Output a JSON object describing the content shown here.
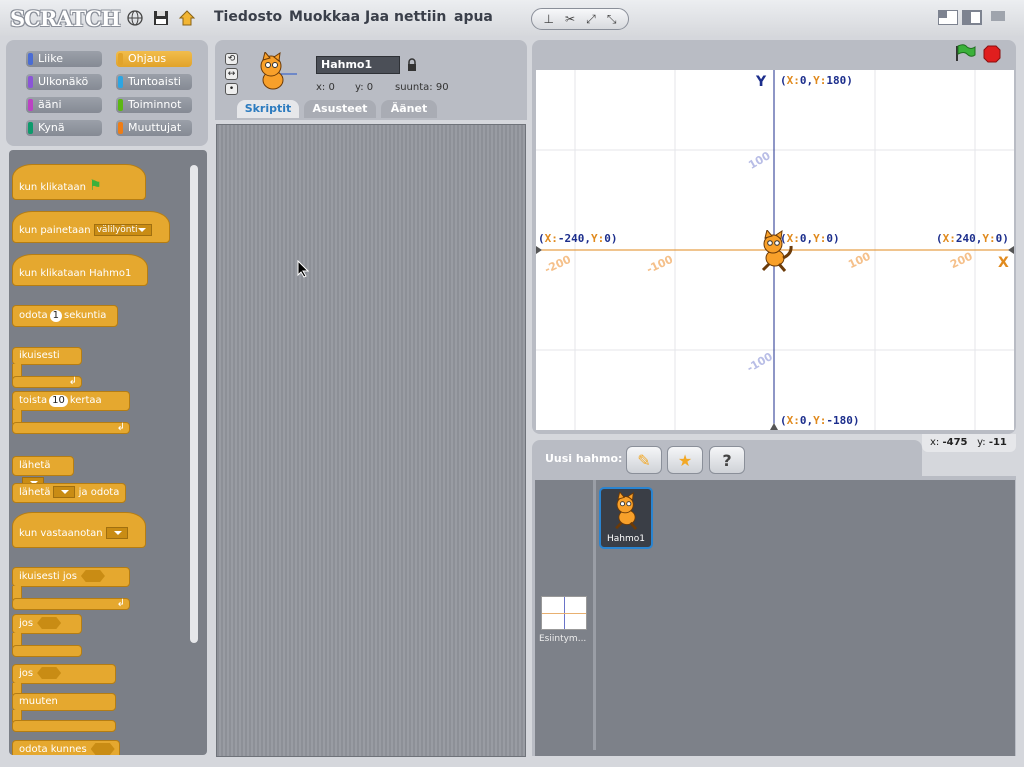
{
  "app": {
    "logo": "SCRATCH"
  },
  "menu": {
    "items": [
      "Tiedosto",
      "Muokkaa",
      "Jaa nettiin",
      "apua"
    ]
  },
  "categories": [
    {
      "label": "Liike",
      "color": "#4a6cd4",
      "selected": false
    },
    {
      "label": "Ohjaus",
      "color": "#e1a32a",
      "selected": true
    },
    {
      "label": "Ulkonäkö",
      "color": "#8a55d7",
      "selected": false
    },
    {
      "label": "Tuntoaisti",
      "color": "#2ca5e2",
      "selected": false
    },
    {
      "label": "ääni",
      "color": "#bb42c3",
      "selected": false
    },
    {
      "label": "Toiminnot",
      "color": "#5cb712",
      "selected": false
    },
    {
      "label": "Kynä",
      "color": "#0e9a6c",
      "selected": false
    },
    {
      "label": "Muuttujat",
      "color": "#ee7d16",
      "selected": false
    }
  ],
  "blocks": {
    "when_flag": "kun klikataan",
    "when_key": "kun painetaan",
    "when_key_value": "välilyönti",
    "when_sprite_clicked": "kun klikataan Hahmo1",
    "wait": "odota",
    "wait_value": "1",
    "wait_unit": "sekuntia",
    "forever": "ikuisesti",
    "repeat": "toista",
    "repeat_value": "10",
    "repeat_unit": "kertaa",
    "broadcast": "lähetä",
    "broadcast_wait": "lähetä",
    "broadcast_wait_suffix": "ja odota",
    "when_receive": "kun vastaanotan",
    "forever_if": "ikuisesti jos",
    "if": "jos",
    "if_else_if": "jos",
    "if_else_else": "muuten",
    "wait_until": "odota kunnes"
  },
  "sprite_info": {
    "name": "Hahmo1",
    "x_label": "x:",
    "x_value": "0",
    "y_label": "y:",
    "y_value": "0",
    "dir_label": "suunta:",
    "dir_value": "90"
  },
  "tabs": [
    "Skriptit",
    "Asusteet",
    "Äänet"
  ],
  "stage": {
    "y_axis_label": "Y",
    "x_axis_label": "X",
    "top": {
      "x": "0",
      "y": "180"
    },
    "bottom": {
      "x": "0",
      "y": "-180"
    },
    "left": {
      "x": "-240",
      "y": "0"
    },
    "right": {
      "x": "240",
      "y": "0"
    },
    "center": {
      "x": "0",
      "y": "0"
    },
    "x_ticks": [
      "-200",
      "-100",
      "100",
      "200"
    ],
    "y_ticks": [
      "100",
      "-100"
    ]
  },
  "mouse": {
    "x_label": "x:",
    "x_value": "-475",
    "y_label": "y:",
    "y_value": "-11"
  },
  "new_sprite_label": "Uusi hahmo:",
  "sprites": [
    {
      "name": "Hahmo1"
    }
  ],
  "stage_thumb_label": "Esiintym..."
}
